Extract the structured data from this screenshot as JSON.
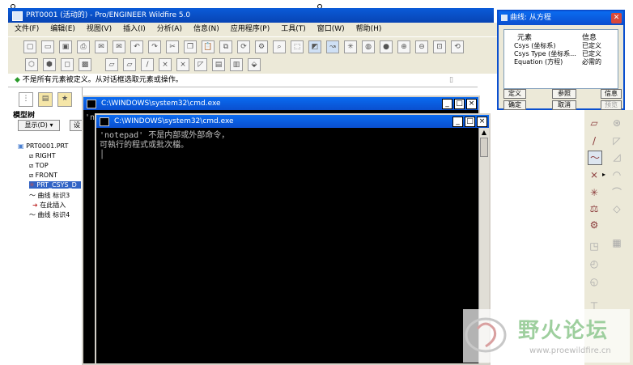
{
  "proe": {
    "title": "PRT0001 (活动的) - Pro/ENGINEER Wildfire 5.0",
    "menus": [
      "文件(F)",
      "编辑(E)",
      "视图(V)",
      "插入(I)",
      "分析(A)",
      "信息(N)",
      "应用程序(P)",
      "工具(T)",
      "窗口(W)",
      "帮助(H)"
    ],
    "message": "不是所有元素被定义。从对话框选取元素或操作。",
    "tree_title": "模型树",
    "tree_display": "显示(D) ▾",
    "tree_settings": "设",
    "tree_items": [
      "PRT0001.PRT",
      "RIGHT",
      "TOP",
      "FRONT",
      "PRT_CSYS_D",
      "曲线 标识3",
      "在此插入",
      "曲线 标识4"
    ]
  },
  "cmd_back": {
    "title": "C:\\WINDOWS\\system32\\cmd.exe",
    "partial": "'n"
  },
  "cmd_front": {
    "title": "C:\\WINDOWS\\system32\\cmd.exe",
    "line1": "'notepad' 不是内部或外部命令，",
    "line2": "可執行的程式或批次檔。"
  },
  "dialog": {
    "title": "曲线: 从方程",
    "col_element": "元素",
    "col_info": "信息",
    "rows": [
      {
        "element": "Csys (坐标系)",
        "info": "已定义"
      },
      {
        "element": "Csys Type (坐标系...",
        "info": "已定义"
      },
      {
        "element": "Equation (方程)",
        "info": "必需的"
      }
    ],
    "btn_define": "定义",
    "btn_reference": "参照",
    "btn_info": "信息",
    "btn_ok": "确定",
    "btn_cancel": "取消",
    "btn_preview": "预览"
  },
  "watermark": {
    "text": "野火论坛",
    "url": "www.proewildfire.cn"
  }
}
